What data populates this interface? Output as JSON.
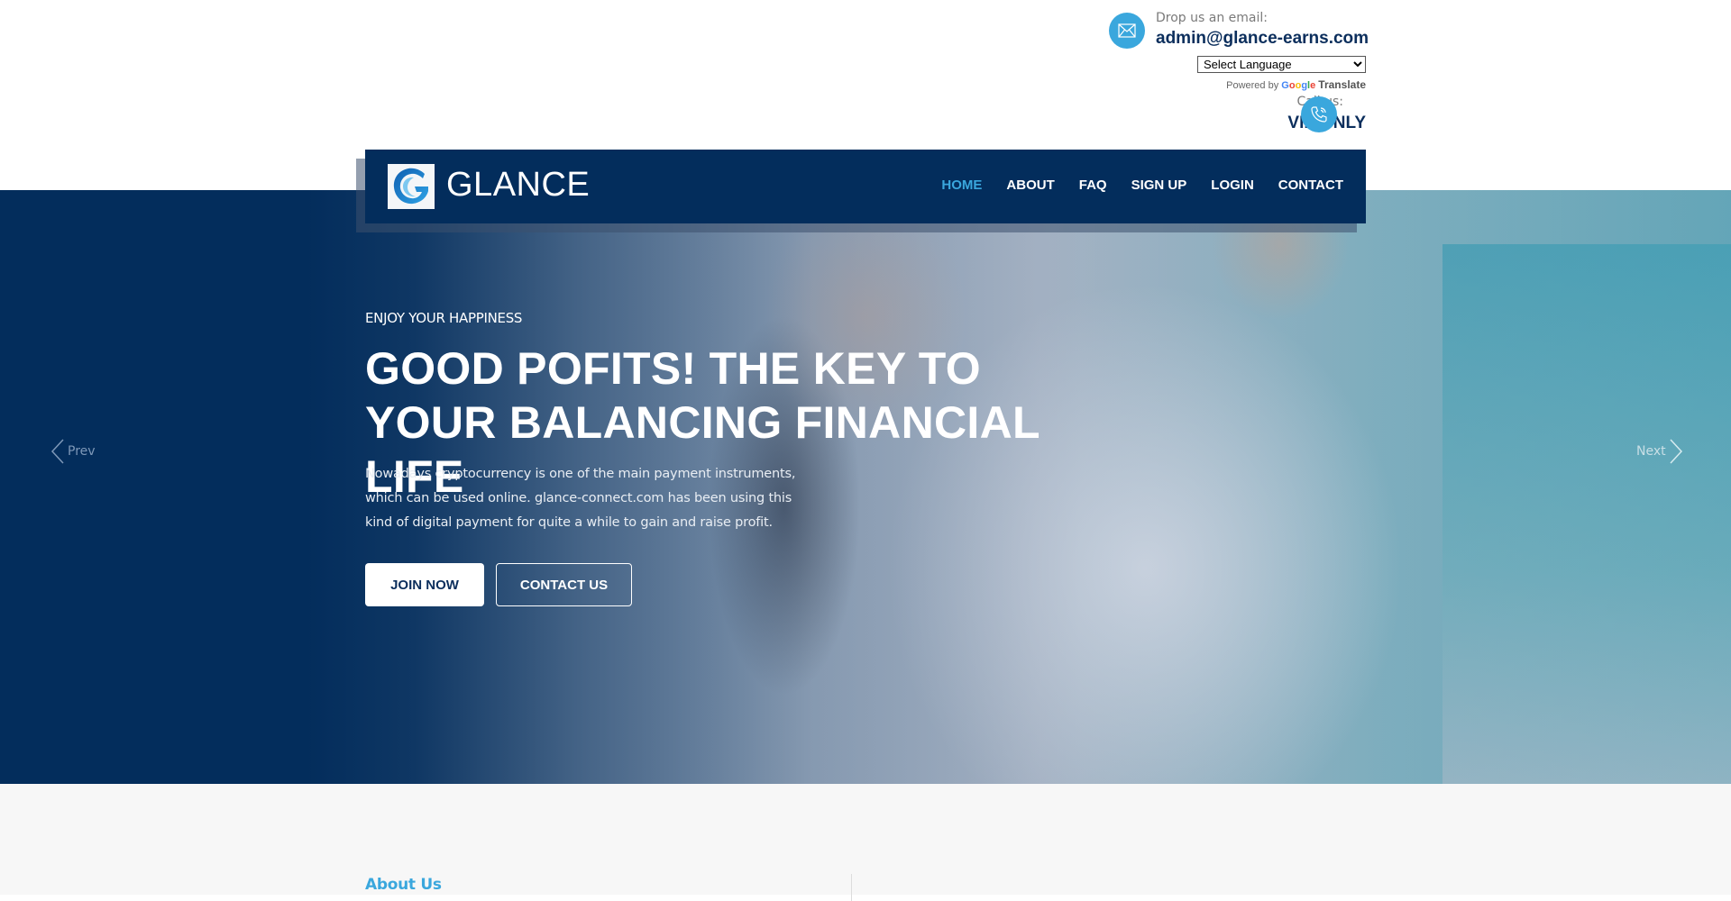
{
  "contact": {
    "email_label": "Drop us an email:",
    "email_value": "admin@glance-earns.com",
    "call_label": "Call us:",
    "call_value": "VIP ONLY"
  },
  "translate": {
    "select_label": "Select Language",
    "powered_by": "Powered by",
    "google": "Google",
    "translate": "Translate"
  },
  "nav": {
    "brand": "GLANCE",
    "links": [
      {
        "label": "HOME",
        "active": true
      },
      {
        "label": "ABOUT"
      },
      {
        "label": "FAQ"
      },
      {
        "label": "SIGN UP"
      },
      {
        "label": "LOGIN"
      },
      {
        "label": "CONTACT"
      }
    ]
  },
  "hero": {
    "kicker": "ENJOY YOUR HAPPINESS",
    "title": "GOOD POFITS! THE KEY TO YOUR BALANCING FINANCIAL LIFE",
    "description": "Nowadays cryptocurrency is one of the main payment instruments, which can be used online. glance-connect.com has been using this kind of digital payment for quite a while to gain and raise profit.",
    "join_label": "JOIN NOW",
    "contact_label": "CONTACT US",
    "prev_label": "Prev",
    "next_label": "Next"
  },
  "about": {
    "title": "About Us"
  },
  "colors": {
    "navy": "#032d5c",
    "accent": "#3aa7dd",
    "dark_text": "#0b2e5c"
  }
}
